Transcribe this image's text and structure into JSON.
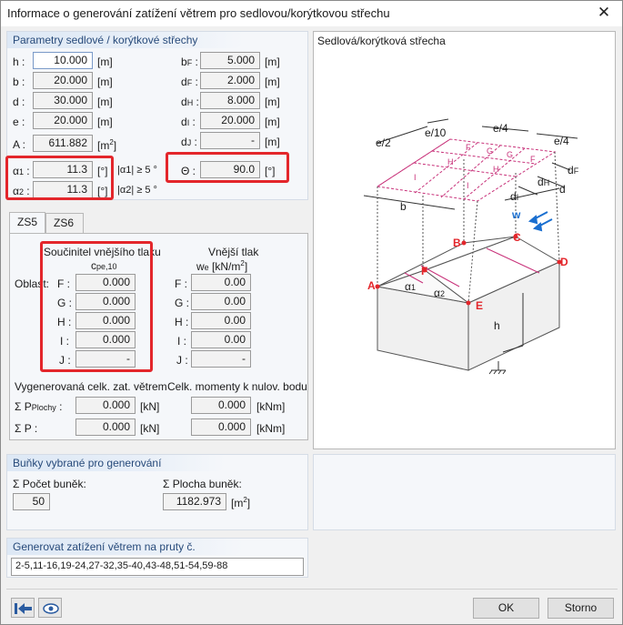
{
  "window": {
    "title": "Informace o generování zatížení větrem pro sedlovou/korýtkovou střechu",
    "close_glyph": "✕"
  },
  "params": {
    "heading": "Parametry sedlové / korýtkové střechy",
    "h": {
      "label": "h :",
      "value": "10.000",
      "unit": "[m]"
    },
    "b": {
      "label": "b :",
      "value": "20.000",
      "unit": "[m]"
    },
    "d": {
      "label": "d :",
      "value": "30.000",
      "unit": "[m]"
    },
    "e": {
      "label": "e :",
      "value": "20.000",
      "unit": "[m]"
    },
    "A": {
      "label": "A :",
      "value": "611.882",
      "unit": "[m",
      "unit_sup": "2",
      "unit_end": "]"
    },
    "bF": {
      "label": "b",
      "sub": "F",
      "value": "5.000",
      "unit": "[m]"
    },
    "dF": {
      "label": "d",
      "sub": "F",
      "value": "2.000",
      "unit": "[m]"
    },
    "dH": {
      "label": "d",
      "sub": "H",
      "value": "8.000",
      "unit": "[m]"
    },
    "dI": {
      "label": "d",
      "sub": "I",
      "value": "20.000",
      "unit": "[m]"
    },
    "dJ": {
      "label": "d",
      "sub": "J",
      "value": "-",
      "unit": "[m]"
    },
    "alpha1": {
      "label": "α",
      "sub": "1",
      "value": "11.3",
      "unit": "[°]",
      "cond": "|α1| ≥ 5 °"
    },
    "alpha2": {
      "label": "α",
      "sub": "2",
      "value": "11.3",
      "unit": "[°]",
      "cond": "|α2| ≥ 5 °"
    },
    "theta": {
      "label": "Θ :",
      "value": "90.0",
      "unit": "[°]"
    }
  },
  "diagram": {
    "heading": "Sedlová/korýtková střecha",
    "labels": {
      "e2": "e/2",
      "e10": "e/10",
      "e4a": "e/4",
      "e4b": "e/4",
      "zF1": "F",
      "zG1": "G",
      "zG2": "G",
      "zF2": "F",
      "zH1": "H",
      "zH2": "H",
      "zI1": "I",
      "zI2": "I",
      "dF": "d",
      "dFsub": "F",
      "dH": "d",
      "dHsub": "H",
      "dI": "d",
      "dIsub": "I",
      "d": "d",
      "b": "b",
      "w": "w",
      "A": "A",
      "B": "B",
      "C": "C",
      "D": "D",
      "E": "E",
      "F": "F",
      "a1": "α",
      "a1sub": "1",
      "a2": "α",
      "a2sub": "2",
      "h": "h"
    }
  },
  "tabs": {
    "zs5": "ZS5",
    "zs6": "ZS6"
  },
  "coef": {
    "cpe_title": "Součinitel vnějšího tlaku",
    "cpe_sym": "c",
    "cpe_sub": "pe,10",
    "we_title": "Vnější tlak",
    "we_sym": "w",
    "we_sub": "e",
    "we_unit": " [kN/m",
    "we_unit_sup": "2",
    "we_unit_end": "]",
    "oblast": "Oblast:",
    "rows": [
      {
        "zone": "F :",
        "cpe": "0.000",
        "we": "0.00"
      },
      {
        "zone": "G :",
        "cpe": "0.000",
        "we": "0.00"
      },
      {
        "zone": "H :",
        "cpe": "0.000",
        "we": "0.00"
      },
      {
        "zone": "I :",
        "cpe": "0.000",
        "we": "0.00"
      },
      {
        "zone": "J :",
        "cpe": "-",
        "we": "-"
      }
    ],
    "gen_heading": "Vygenerovaná celk. zat. větrem",
    "mom_heading": "Celk. momenty k nulov. bodu",
    "sum_pplochy_label": "Σ P",
    "sum_pplochy_sub": "Plochy",
    "sum_pplochy_colon": " :",
    "sum_pplochy_value": "0.000",
    "sum_pplochy_unit": "[kN]",
    "sum_p_label": "Σ P :",
    "sum_p_value": "0.000",
    "sum_p_unit": "[kN]",
    "mom1_value": "0.000",
    "mom1_unit": "[kNm]",
    "mom2_value": "0.000",
    "mom2_unit": "[kNm]"
  },
  "cells": {
    "heading": "Buňky vybrané pro generování",
    "count_label": "Σ Počet buněk:",
    "count_value": "50",
    "area_label": "Σ Plocha buněk:",
    "area_value": "1182.973",
    "area_unit": "[m",
    "area_unit_sup": "2",
    "area_unit_end": "]"
  },
  "members": {
    "heading": "Generovat zatížení větrem na pruty č.",
    "value": "2-5,11-16,19-24,27-32,35-40,43-48,51-54,59-88"
  },
  "footer": {
    "ok": "OK",
    "cancel": "Storno"
  },
  "colors": {
    "red_highlight": "#e3262b",
    "zone_line": "#c8327a",
    "panel_head": "#274a7a"
  }
}
